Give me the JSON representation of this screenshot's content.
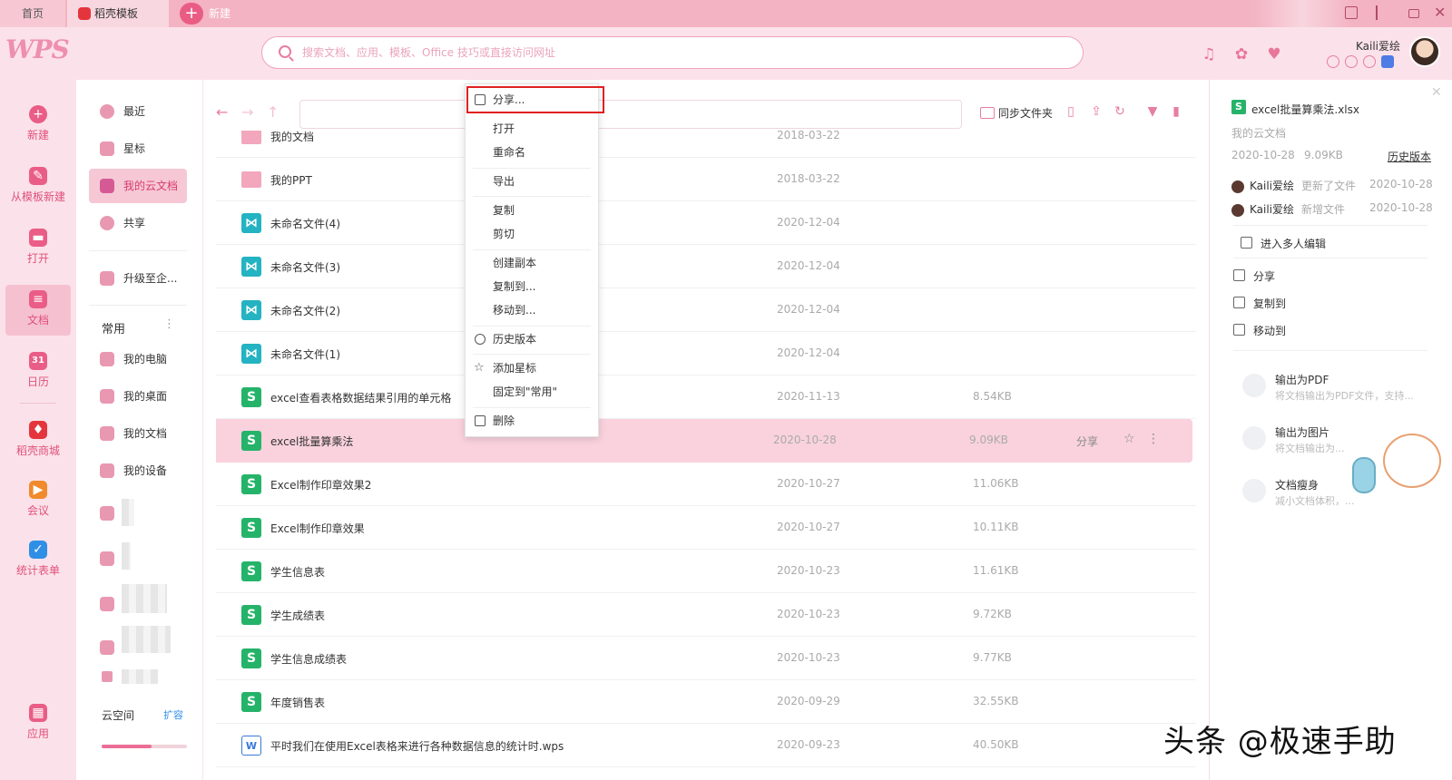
{
  "tabs": {
    "home": "首页",
    "daoke": "稻壳模板",
    "new": "新建"
  },
  "header": {
    "logo": "WPS",
    "search_placeholder": "搜索文档、应用、模板、Office 技巧或直接访问网址",
    "user_name": "Kaili爱绘"
  },
  "leftnav": {
    "items": [
      {
        "label": "新建",
        "icon": "+"
      },
      {
        "label": "从模板新建",
        "icon": "✎"
      },
      {
        "label": "打开",
        "icon": "▬"
      },
      {
        "label": "文档",
        "icon": "≡"
      },
      {
        "label": "日历",
        "icon": "31"
      },
      {
        "label": "稻壳商城",
        "icon": "♦"
      },
      {
        "label": "会议",
        "icon": "▶"
      },
      {
        "label": "统计表单",
        "icon": "✓"
      },
      {
        "label": "应用",
        "icon": "▦"
      }
    ]
  },
  "folders": {
    "items": [
      {
        "label": "最近"
      },
      {
        "label": "星标"
      },
      {
        "label": "我的云文档"
      },
      {
        "label": "共享"
      },
      {
        "label": "升级至企..."
      }
    ],
    "common_title": "常用",
    "common_items": [
      {
        "label": "我的电脑"
      },
      {
        "label": "我的桌面"
      },
      {
        "label": "我的文档"
      },
      {
        "label": "我的设备"
      }
    ],
    "cloud_label": "云空间",
    "expand_label": "扩容",
    "cloud_usage": 0.58
  },
  "toolbar": {
    "sync_label": "同步文件夹"
  },
  "files": [
    {
      "name": "我的文档",
      "type": "folder",
      "date": "2018-03-22",
      "size": ""
    },
    {
      "name": "我的PPT",
      "type": "folder",
      "date": "2018-03-22",
      "size": ""
    },
    {
      "name": "未命名文件(4)",
      "type": "share",
      "date": "2020-12-04",
      "size": ""
    },
    {
      "name": "未命名文件(3)",
      "type": "share",
      "date": "2020-12-04",
      "size": ""
    },
    {
      "name": "未命名文件(2)",
      "type": "share",
      "date": "2020-12-04",
      "size": ""
    },
    {
      "name": "未命名文件(1)",
      "type": "share",
      "date": "2020-12-04",
      "size": ""
    },
    {
      "name": "excel查看表格数据结果引用的单元格",
      "type": "excel",
      "date": "2020-11-13",
      "size": "8.54KB"
    },
    {
      "name": "excel批量算乘法",
      "type": "excel",
      "date": "2020-10-28",
      "size": "9.09KB",
      "selected": true,
      "share_label": "分享"
    },
    {
      "name": "Excel制作印章效果2",
      "type": "excel",
      "date": "2020-10-27",
      "size": "11.06KB"
    },
    {
      "name": "Excel制作印章效果",
      "type": "excel",
      "date": "2020-10-27",
      "size": "10.11KB"
    },
    {
      "name": "学生信息表",
      "type": "excel",
      "date": "2020-10-23",
      "size": "11.61KB"
    },
    {
      "name": "学生成绩表",
      "type": "excel",
      "date": "2020-10-23",
      "size": "9.72KB"
    },
    {
      "name": "学生信息成绩表",
      "type": "excel",
      "date": "2020-10-23",
      "size": "9.77KB"
    },
    {
      "name": "年度销售表",
      "type": "excel",
      "date": "2020-09-29",
      "size": "32.55KB"
    },
    {
      "name": "平时我们在使用Excel表格来进行各种数据信息的统计时.wps",
      "type": "word",
      "date": "2020-09-23",
      "size": "40.50KB"
    }
  ],
  "context_menu": {
    "share": "分享...",
    "open": "打开",
    "rename": "重命名",
    "export": "导出",
    "copy": "复制",
    "cut": "剪切",
    "duplicate": "创建副本",
    "copy_to": "复制到...",
    "move_to": "移动到...",
    "history": "历史版本",
    "star": "添加星标",
    "pin": "固定到\"常用\"",
    "delete": "删除"
  },
  "rpanel": {
    "file_name": "excel批量算乘法.xlsx",
    "location": "我的云文档",
    "date": "2020-10-28",
    "size": "9.09KB",
    "history_link": "历史版本",
    "activities": [
      {
        "user": "Kaili爱绘",
        "desc": "更新了文件",
        "date": "2020-10-28"
      },
      {
        "user": "Kaili爱绘",
        "desc": "新增文件",
        "date": "2020-10-28"
      }
    ],
    "multi_edit": "进入多人编辑",
    "share": "分享",
    "copy_to": "复制到",
    "move_to": "移动到",
    "tools": [
      {
        "name": "输出为PDF",
        "desc": "将文档输出为PDF文件，支持..."
      },
      {
        "name": "输出为图片",
        "desc": "将文档输出为..."
      },
      {
        "name": "文档瘦身",
        "desc": "减小文档体积，..."
      }
    ]
  },
  "watermark": "头条 @极速手助"
}
